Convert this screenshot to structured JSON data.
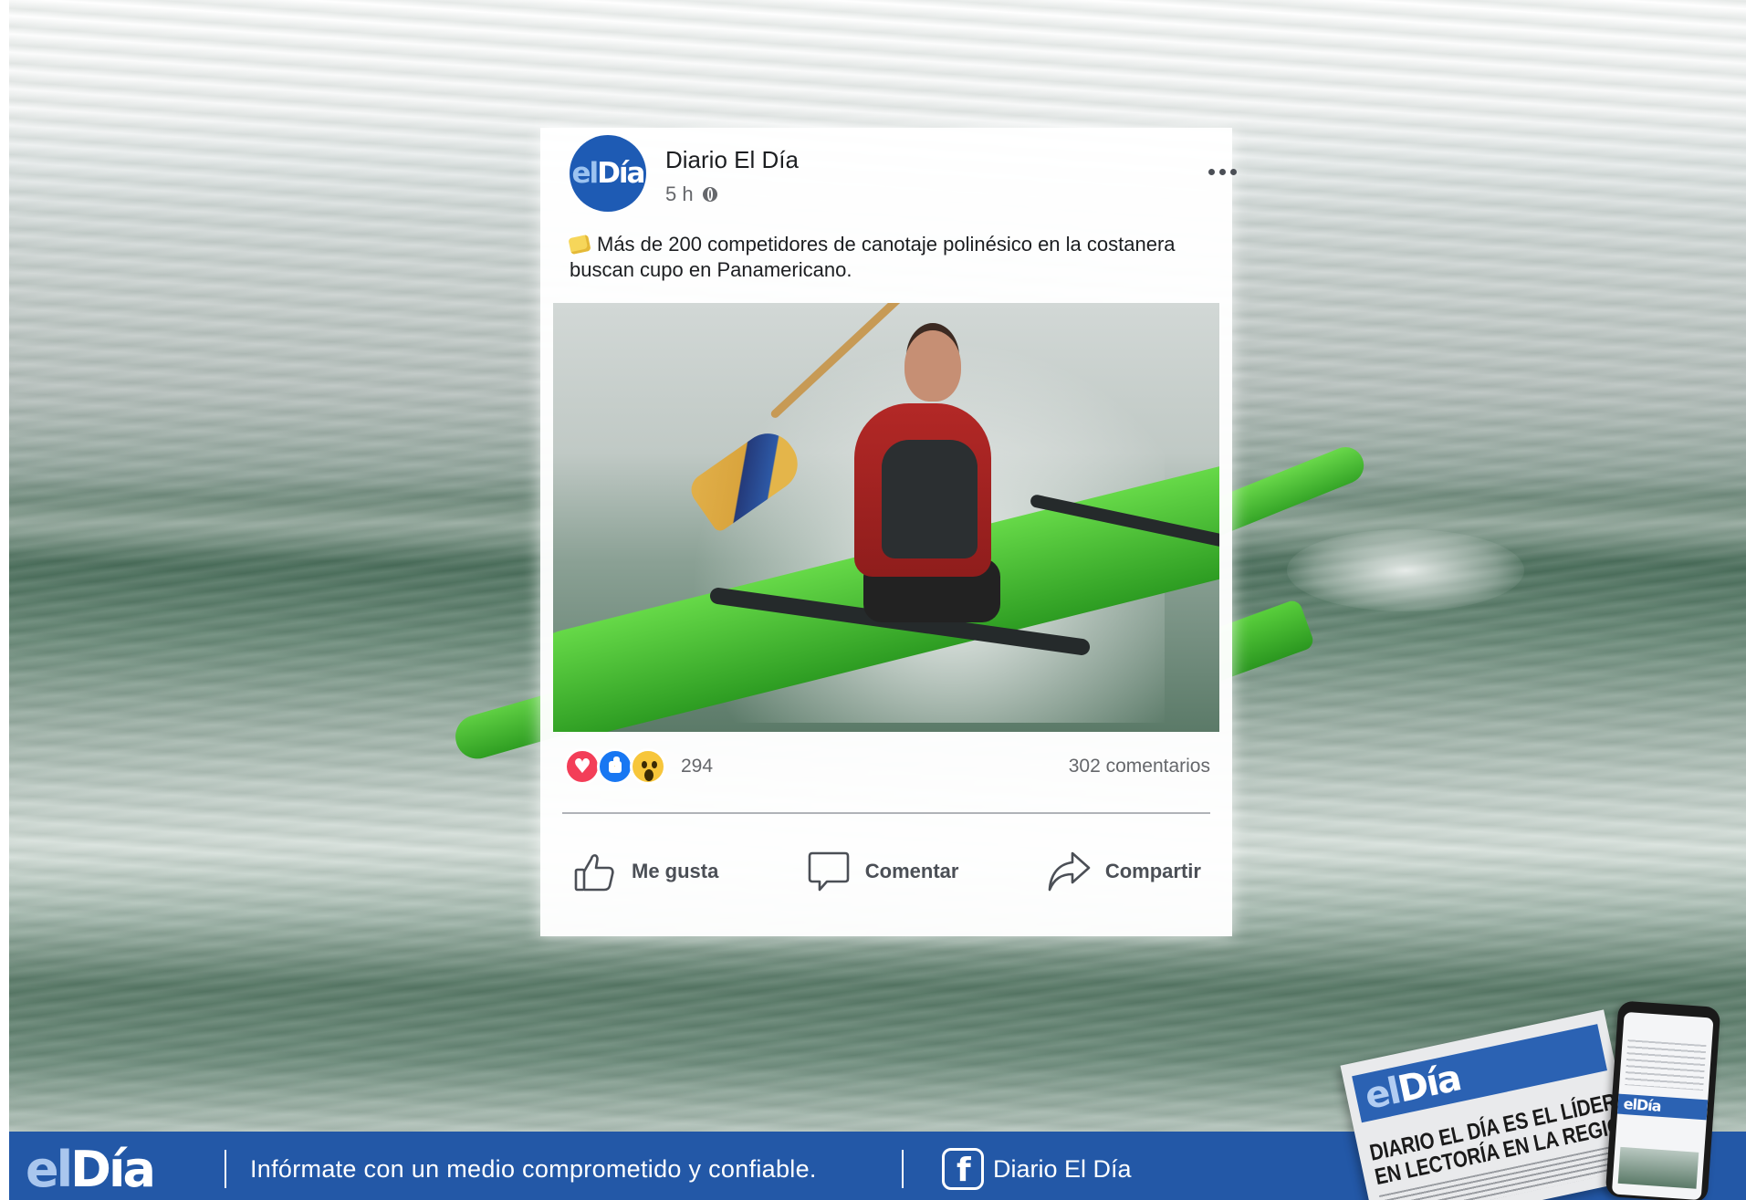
{
  "post": {
    "page_name": "Diario El Día",
    "time": "5 h",
    "text": "Más de 200 competidores de canotaje polinésico en la costanera buscan cupo en Panamericano.",
    "reaction_count": "294",
    "comments": "302 comentarios",
    "actions": {
      "like": "Me gusta",
      "comment": "Comentar",
      "share": "Compartir"
    }
  },
  "avatar": {
    "prefix": "el",
    "suffix": "Día"
  },
  "banner": {
    "logo_prefix": "el",
    "logo_suffix": "Día",
    "tagline": "Infórmate con un medio comprometido y confiable.",
    "facebook_label": "Diario El Día"
  },
  "promo": {
    "newspaper_logo_prefix": "el",
    "newspaper_logo_suffix": "Día",
    "newspaper_headline_line1": "DIARIO EL DÍA ES EL LÍDER",
    "newspaper_headline_line2": "EN LECTORÍA EN LA REGIÓN",
    "phone_logo": "elDía"
  },
  "colors": {
    "brand_blue": "#2358a7",
    "avatar_blue": "#1e5bb4",
    "love_red": "#f33e58",
    "like_blue": "#1877f2",
    "wow_yellow": "#f7c63b",
    "canoe_green": "#4cc13a"
  },
  "icons": {
    "more": "more-options-icon",
    "privacy": "globe-icon",
    "like": "thumbs-up-icon",
    "comment": "speech-bubble-icon",
    "share": "share-arrow-icon",
    "facebook": "facebook-icon"
  }
}
